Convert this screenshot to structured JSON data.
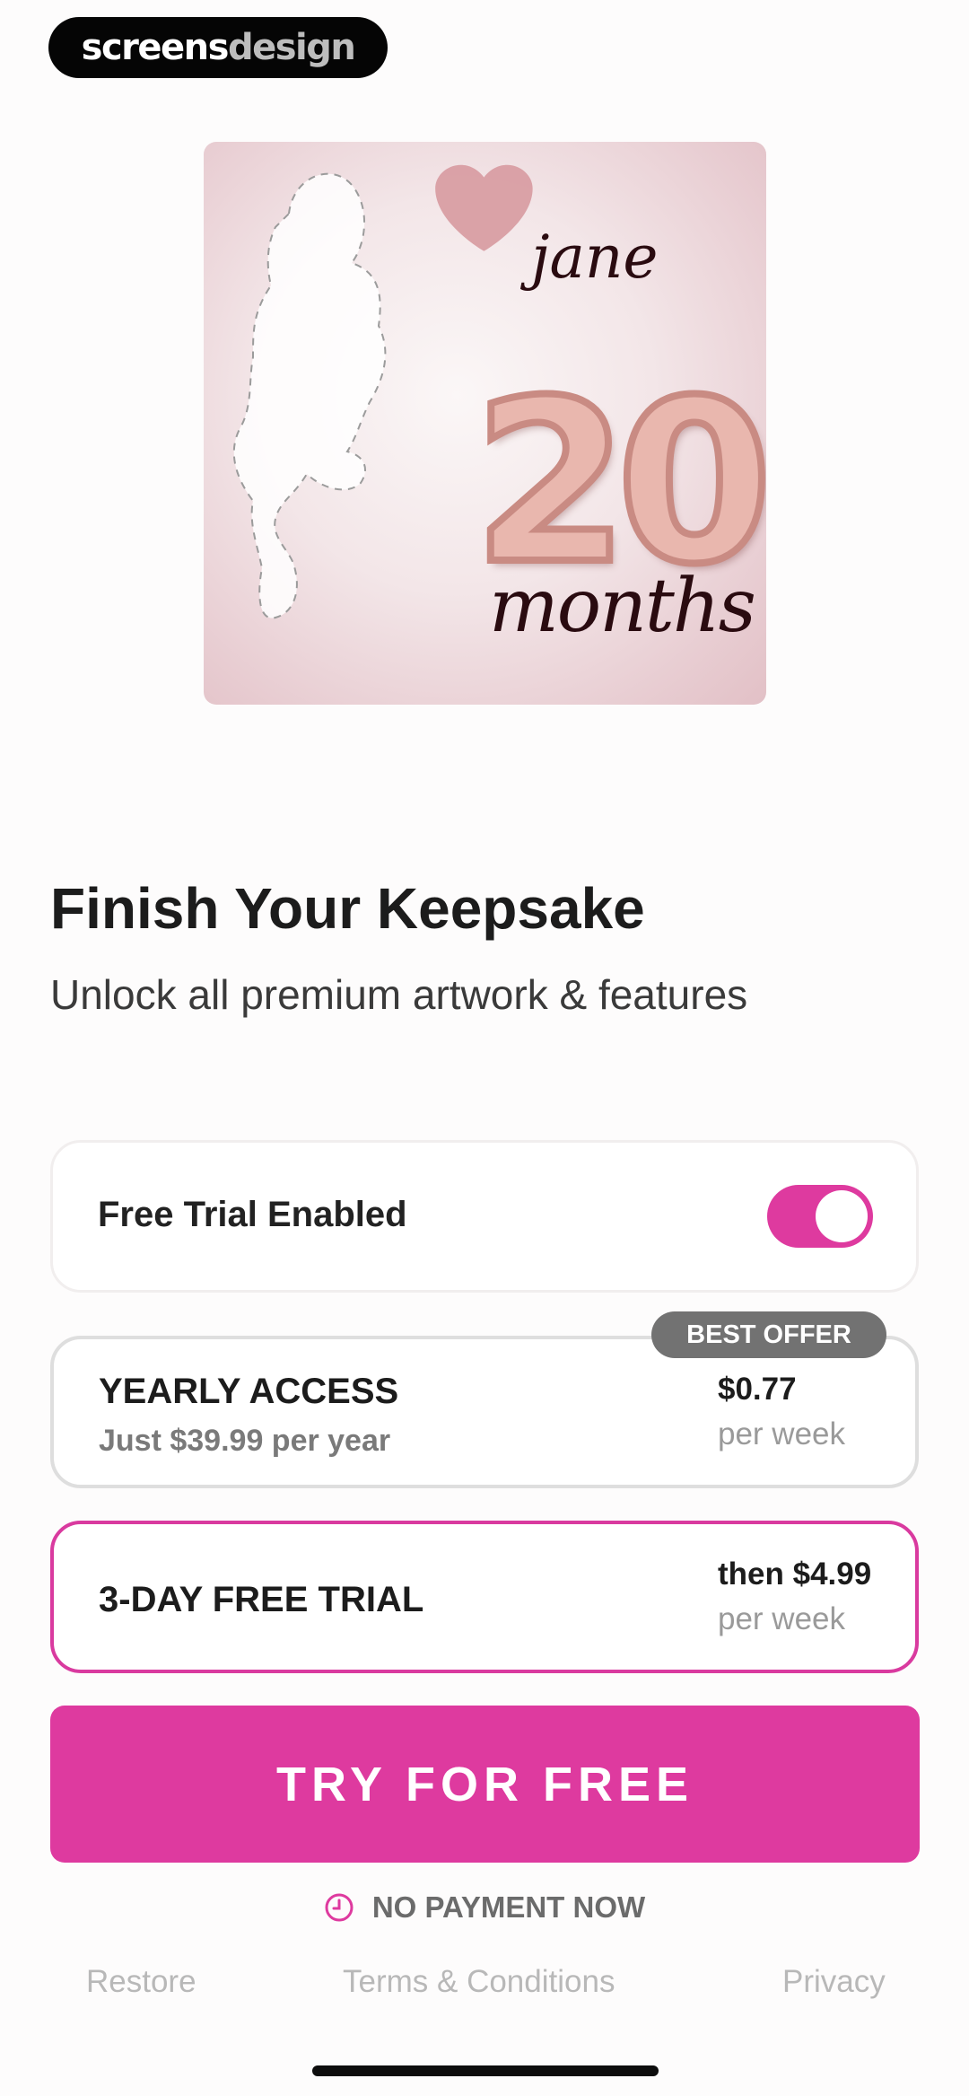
{
  "brand": {
    "part1": "screens",
    "part2": "design"
  },
  "artwork": {
    "name": "jane",
    "number": "20",
    "unit": "months"
  },
  "header": {
    "title": "Finish Your Keepsake",
    "subtitle": "Unlock all premium artwork & features"
  },
  "trial_toggle": {
    "label": "Free Trial Enabled",
    "enabled": true
  },
  "plans": [
    {
      "id": "yearly",
      "name": "YEARLY ACCESS",
      "detail": "Just $39.99 per year",
      "price": "$0.77",
      "price_unit": "per week",
      "badge": "BEST OFFER",
      "selected": false
    },
    {
      "id": "trial",
      "name": "3-DAY FREE TRIAL",
      "price": "then $4.99",
      "price_unit": "per week",
      "selected": true
    }
  ],
  "cta": {
    "label": "TRY FOR FREE"
  },
  "no_payment": {
    "icon": "clock-icon",
    "text": "NO PAYMENT NOW"
  },
  "footer": {
    "restore": "Restore",
    "terms": "Terms & Conditions",
    "privacy": "Privacy"
  },
  "colors": {
    "accent": "#de3a9f",
    "badge": "#727272",
    "text": "#1c1c1c"
  }
}
